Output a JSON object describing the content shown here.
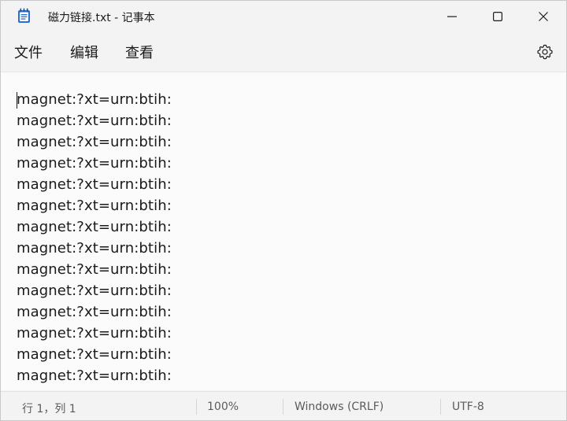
{
  "window": {
    "title": "磁力链接.txt - 记事本"
  },
  "menu": {
    "file": "文件",
    "edit": "编辑",
    "view": "查看"
  },
  "editor": {
    "lines": [
      "magnet:?xt=urn:btih:",
      "magnet:?xt=urn:btih:",
      "magnet:?xt=urn:btih:",
      "magnet:?xt=urn:btih:",
      "magnet:?xt=urn:btih:",
      "magnet:?xt=urn:btih:",
      "magnet:?xt=urn:btih:",
      "magnet:?xt=urn:btih:",
      "magnet:?xt=urn:btih:",
      "magnet:?xt=urn:btih:",
      "magnet:?xt=urn:btih:",
      "magnet:?xt=urn:btih:",
      "magnet:?xt=urn:btih:",
      "magnet:?xt=urn:btih:"
    ]
  },
  "status": {
    "position": "行 1，列 1",
    "zoom": "100%",
    "line_ending": "Windows (CRLF)",
    "encoding": "UTF-8"
  },
  "icons": {
    "app": "notepad-icon",
    "minimize": "minimize-icon",
    "maximize": "maximize-icon",
    "close": "close-icon",
    "settings": "gear-icon"
  },
  "colors": {
    "app_icon_blue": "#2b6fd6",
    "window_bg": "#f3f3f3",
    "editor_bg": "#fbfbfb"
  }
}
